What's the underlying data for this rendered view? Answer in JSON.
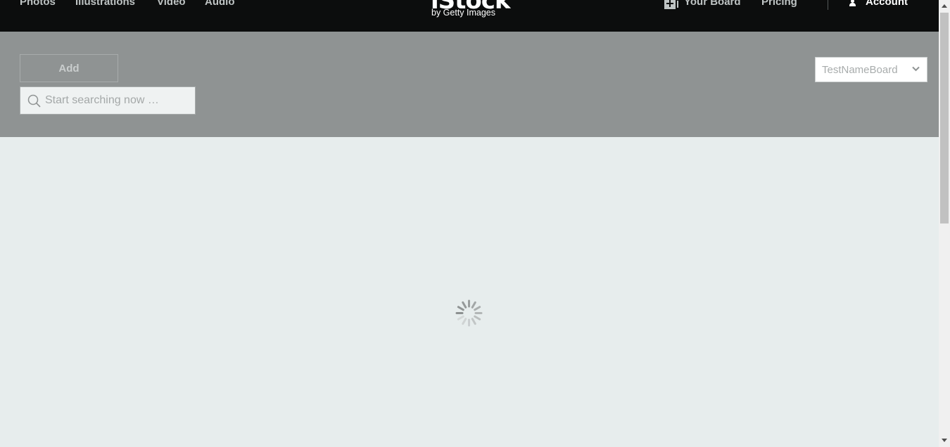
{
  "nav": {
    "links": [
      "Photos",
      "Illustrations",
      "Video",
      "Audio"
    ],
    "logo_word": "iStock",
    "logo_sub": "by Getty Images",
    "your_board": "Your Board",
    "pricing": "Pricing",
    "account": "Account"
  },
  "board": {
    "add_label": "Add",
    "search_placeholder": "Start searching now …",
    "selected_board": "TestNameBoard"
  },
  "main": {
    "loading": true
  },
  "colors": {
    "nav_bg": "#0c0d0d",
    "header_bg": "#8f9393",
    "content_bg": "#e7eded"
  },
  "icons": [
    "board-add-icon",
    "user-icon",
    "search-icon",
    "chevron-down-icon",
    "loading-spinner-icon"
  ]
}
